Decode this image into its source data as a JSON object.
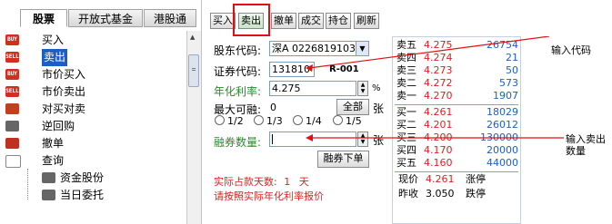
{
  "left_tabs": [
    "股票",
    "开放式基金",
    "港股通"
  ],
  "tree_items": [
    {
      "label": "买入",
      "icon": "buy-icon",
      "icon_text": "BUY",
      "color": "#d03020"
    },
    {
      "label": "卖出",
      "icon": "sell-icon",
      "icon_text": "SELL",
      "color": "#d03020",
      "selected": true
    },
    {
      "label": "市价买入",
      "icon": "buy-icon",
      "icon_text": "BUY",
      "color": "#d03020"
    },
    {
      "label": "市价卖出",
      "icon": "sell-icon",
      "icon_text": "SELL",
      "color": "#d03020"
    },
    {
      "label": "对买对卖",
      "icon": "swap-icon",
      "icon_text": "",
      "color": "#c04020"
    },
    {
      "label": "逆回购",
      "icon": "repo-icon",
      "icon_text": "",
      "color": "#666666"
    },
    {
      "label": "撤单",
      "icon": "cancel-icon",
      "icon_text": "",
      "color": "#c03020"
    },
    {
      "label": "查询",
      "icon": "collapse-icon",
      "icon_text": "",
      "color": "#888888"
    },
    {
      "label": "资金股份",
      "icon": "query-icon",
      "icon_text": "",
      "color": "#666666"
    },
    {
      "label": "当日委托",
      "icon": "query-icon",
      "icon_text": "",
      "color": "#666666"
    }
  ],
  "toolbar": [
    "买入",
    "卖出",
    "撤单",
    "成交",
    "持仓",
    "刷新"
  ],
  "form": {
    "account_label": "股东代码:",
    "account_value": "深A 0226819103",
    "code_label": "证券代码:",
    "code_value": "131810",
    "code_name": "R-001",
    "rate_label": "年化利率:",
    "rate_value": "4.275",
    "rate_unit": "%",
    "max_label": "最大可融:",
    "max_value": "0",
    "all_button": "全部",
    "max_unit": "张",
    "fractions": [
      "1/2",
      "1/3",
      "1/4",
      "1/5"
    ],
    "qty_label": "融券数量:",
    "qty_value": "",
    "qty_unit": "张",
    "submit_button": "融券下单",
    "days_label": "实际占款天数:",
    "days_value": "1",
    "days_unit": "天",
    "hint": "请按照实际年化利率报价"
  },
  "quote": {
    "sell_levels": [
      {
        "label": "卖五",
        "price": "4.275",
        "vol": "26754"
      },
      {
        "label": "卖四",
        "price": "4.274",
        "vol": "21"
      },
      {
        "label": "卖三",
        "price": "4.273",
        "vol": "50"
      },
      {
        "label": "卖二",
        "price": "4.272",
        "vol": "573"
      },
      {
        "label": "卖一",
        "price": "4.270",
        "vol": "1907"
      }
    ],
    "buy_levels": [
      {
        "label": "买一",
        "price": "4.261",
        "vol": "18029"
      },
      {
        "label": "买二",
        "price": "4.201",
        "vol": "26012"
      },
      {
        "label": "买三",
        "price": "4.200",
        "vol": "130000"
      },
      {
        "label": "买四",
        "price": "4.170",
        "vol": "20000"
      },
      {
        "label": "买五",
        "price": "4.160",
        "vol": "44000"
      }
    ],
    "current_label": "现价",
    "current_value": "4.261",
    "limit_up": "涨停",
    "prev_label": "昨收",
    "prev_value": "3.050",
    "limit_down": "跌停"
  },
  "annotations": {
    "enter_code": "输入代码",
    "enter_sell_1": "输入卖出",
    "enter_sell_2": "数量"
  },
  "colors": {
    "sell_red": "#e02020",
    "buy_blue": "#1c5fc4",
    "label_green": "#2a8a2a",
    "highlight": "#e01010"
  }
}
